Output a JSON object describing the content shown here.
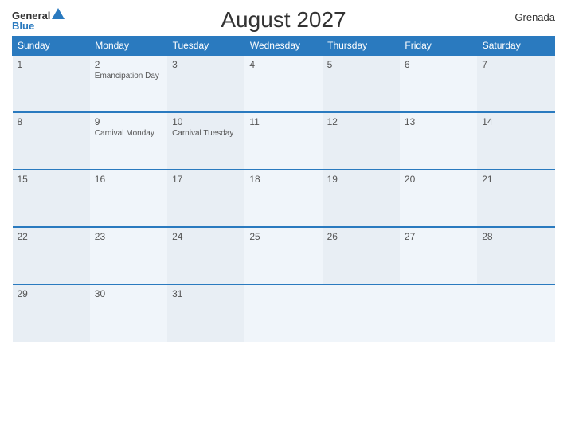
{
  "header": {
    "logo_general": "General",
    "logo_blue": "Blue",
    "title": "August 2027",
    "country": "Grenada"
  },
  "days_of_week": [
    "Sunday",
    "Monday",
    "Tuesday",
    "Wednesday",
    "Thursday",
    "Friday",
    "Saturday"
  ],
  "weeks": [
    [
      {
        "day": "1",
        "holiday": ""
      },
      {
        "day": "2",
        "holiday": "Emancipation Day"
      },
      {
        "day": "3",
        "holiday": ""
      },
      {
        "day": "4",
        "holiday": ""
      },
      {
        "day": "5",
        "holiday": ""
      },
      {
        "day": "6",
        "holiday": ""
      },
      {
        "day": "7",
        "holiday": ""
      }
    ],
    [
      {
        "day": "8",
        "holiday": ""
      },
      {
        "day": "9",
        "holiday": "Carnival Monday"
      },
      {
        "day": "10",
        "holiday": "Carnival Tuesday"
      },
      {
        "day": "11",
        "holiday": ""
      },
      {
        "day": "12",
        "holiday": ""
      },
      {
        "day": "13",
        "holiday": ""
      },
      {
        "day": "14",
        "holiday": ""
      }
    ],
    [
      {
        "day": "15",
        "holiday": ""
      },
      {
        "day": "16",
        "holiday": ""
      },
      {
        "day": "17",
        "holiday": ""
      },
      {
        "day": "18",
        "holiday": ""
      },
      {
        "day": "19",
        "holiday": ""
      },
      {
        "day": "20",
        "holiday": ""
      },
      {
        "day": "21",
        "holiday": ""
      }
    ],
    [
      {
        "day": "22",
        "holiday": ""
      },
      {
        "day": "23",
        "holiday": ""
      },
      {
        "day": "24",
        "holiday": ""
      },
      {
        "day": "25",
        "holiday": ""
      },
      {
        "day": "26",
        "holiday": ""
      },
      {
        "day": "27",
        "holiday": ""
      },
      {
        "day": "28",
        "holiday": ""
      }
    ],
    [
      {
        "day": "29",
        "holiday": ""
      },
      {
        "day": "30",
        "holiday": ""
      },
      {
        "day": "31",
        "holiday": ""
      },
      {
        "day": "",
        "holiday": ""
      },
      {
        "day": "",
        "holiday": ""
      },
      {
        "day": "",
        "holiday": ""
      },
      {
        "day": "",
        "holiday": ""
      }
    ]
  ]
}
